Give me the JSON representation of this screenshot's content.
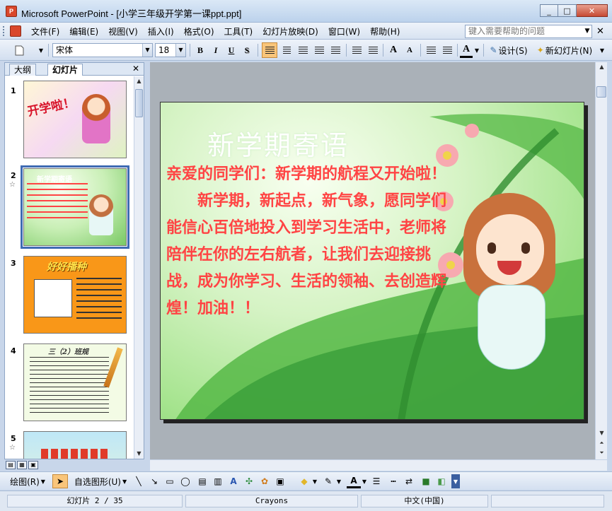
{
  "window": {
    "title": "Microsoft PowerPoint - [小学三年级开学第一课ppt.ppt]",
    "minimize": "_",
    "restore": "□",
    "close": "✕"
  },
  "menu": {
    "items": [
      "文件(F)",
      "编辑(E)",
      "视图(V)",
      "插入(I)",
      "格式(O)",
      "工具(T)",
      "幻灯片放映(D)",
      "窗口(W)",
      "帮助(H)"
    ],
    "help_placeholder": "键入需要帮助的问题"
  },
  "format_toolbar": {
    "font_name": "宋体",
    "font_size": "18",
    "bold": "B",
    "italic": "I",
    "underline": "U",
    "shadow": "S",
    "grow_font": "A",
    "shrink_font": "A",
    "font_color": "A",
    "design_label": "设计(S)",
    "new_slide_label": "新幻灯片(N)"
  },
  "left_pane": {
    "tabs": [
      "大纲",
      "幻灯片"
    ],
    "close": "✕",
    "slides": [
      {
        "num": "1",
        "title": "开学啦！",
        "star": ""
      },
      {
        "num": "2",
        "title": "新学期寄语",
        "star": "☆"
      },
      {
        "num": "3",
        "title": "好好播种",
        "star": ""
      },
      {
        "num": "4",
        "title": "三（2）班规",
        "star": ""
      },
      {
        "num": "5",
        "title": "",
        "star": "☆"
      }
    ]
  },
  "slide": {
    "heading": "新学期寄语",
    "line1": "亲爱的同学们：新学期的航程又开始啦！",
    "line2": "新学期，新起点，新气象，愿同学们能信心百倍地投入到学习生活中，老师将陪伴在你的左右航者，让我们去迎接挑战，成为你学习、生活的领袖、去创造辉煌！加油！！"
  },
  "draw_toolbar": {
    "draw_label": "绘图(R)",
    "autoshape_label": "自选图形(U)"
  },
  "status": {
    "slide_pos": "幻灯片 2 / 35",
    "design": "Crayons",
    "language": "中文(中国)"
  },
  "colors": {
    "slide_text": "#ff4444",
    "selection_outline": "#3f6bb3",
    "title_bar": "#bcd2ec"
  }
}
